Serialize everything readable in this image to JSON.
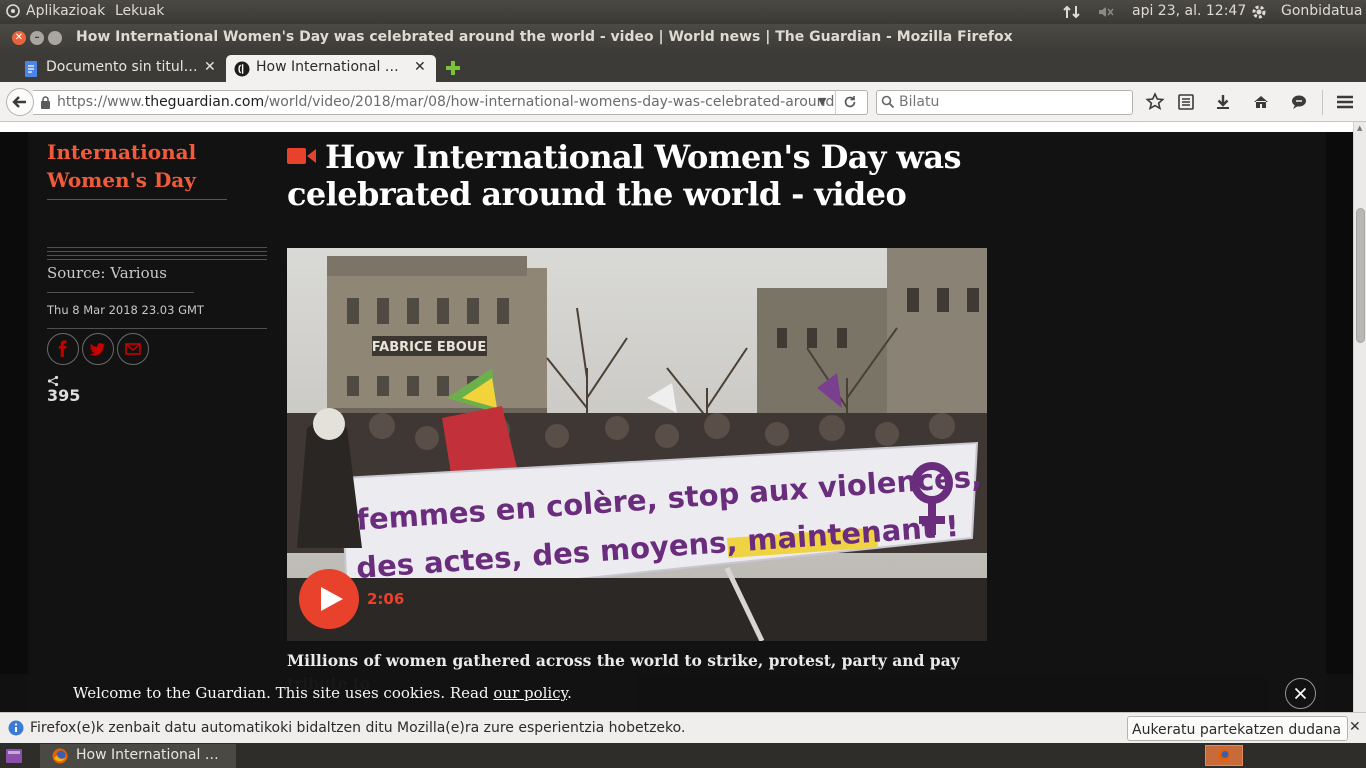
{
  "top_panel": {
    "applications": "Aplikazioak",
    "places": "Lekuak",
    "datetime": "api 23, al. 12:47",
    "user": "Gonbidatua"
  },
  "window": {
    "title": "How International Women's Day was celebrated around the world - video | World news | The Guardian - Mozilla Firefox"
  },
  "tabs": [
    {
      "label": "Documento sin titul…",
      "active": false
    },
    {
      "label": "How International …",
      "active": true
    }
  ],
  "navbar": {
    "url_prefix": "https://www.",
    "url_domain": "theguardian.com",
    "url_path": "/world/video/2018/mar/08/how-international-womens-day-was-celebrated-around",
    "search_placeholder": "Bilatu"
  },
  "article": {
    "section": "International Women's Day",
    "headline": "How International Women's Day was celebrated around the world - video",
    "source": "Source: Various",
    "date": "Thu 8 Mar 2018 23.03 GMT",
    "share_count": "395",
    "video_duration": "2:06",
    "standfirst": "Millions of women gathered across the world to strike, protest, party and pay tribute to",
    "photo_text": {
      "storefront": "FABRICE EBOUE",
      "banner_line1": "femmes en colère, stop aux violences,",
      "banner_line2": "des actes, des moyens, maintenant !"
    }
  },
  "cookie_banner": {
    "text": "Welcome to the Guardian. This site uses cookies. Read ",
    "link": "our policy",
    "suffix": "."
  },
  "notification": {
    "text": "Firefox(e)k zenbait datu automatikoki bidaltzen ditu Mozilla(e)ra zure esperientzia hobetzeko.",
    "button": "Aukeratu partekatzen dudana"
  },
  "taskbar": {
    "item": "How International …"
  },
  "colors": {
    "guardian_accent": "#e8412c",
    "section_orange": "#f25b3a",
    "page_background": "#121212",
    "ubuntu_panel": "#3c3b37"
  }
}
